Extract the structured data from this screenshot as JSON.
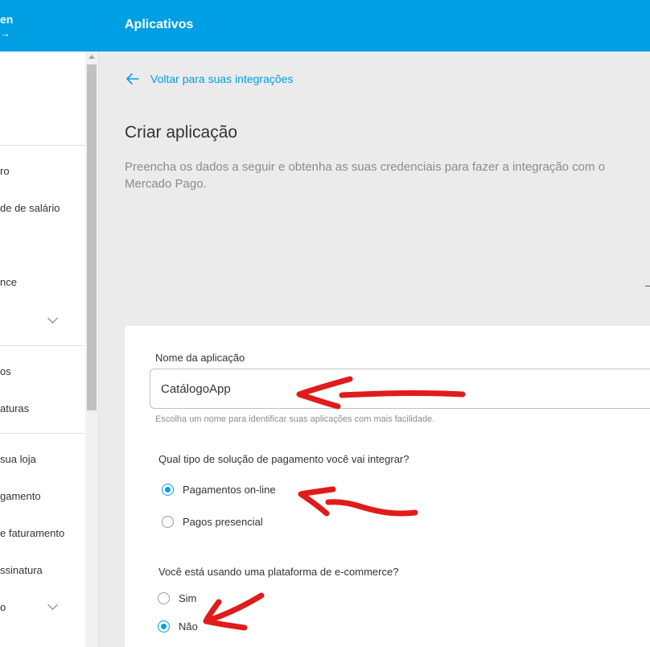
{
  "sidebar": {
    "header_name": "en",
    "header_arrow": "→",
    "items": [
      {
        "label": "ro"
      },
      {
        "label": "de de salário"
      },
      {
        "label": "nce"
      },
      {
        "label": "os"
      },
      {
        "label": "aturas"
      },
      {
        "label": "sua loja"
      },
      {
        "label": "gamento"
      },
      {
        "label": "e faturamento"
      },
      {
        "label": "ssinatura"
      },
      {
        "label": "o"
      }
    ]
  },
  "header": {
    "title": "Aplicativos"
  },
  "main": {
    "back_link": "Voltar para suas integrações",
    "title": "Criar aplicação",
    "description": "Preencha os dados a seguir e obtenha as suas credenciais para fazer a integração com o Mercado Pago."
  },
  "form": {
    "app_name_label": "Nome da aplicação",
    "app_name_value": "CatálogoApp",
    "app_name_helper": "Escolha um nome para identificar suas aplicações com mais facilidade.",
    "payment_question": "Qual tipo de solução de pagamento você vai integrar?",
    "payment_options": [
      {
        "label": "Pagamentos on-line",
        "selected": true
      },
      {
        "label": "Pagos presencial",
        "selected": false
      }
    ],
    "ecommerce_question": "Você está usando uma plataforma de e-commerce?",
    "ecommerce_options": [
      {
        "label": "Sim",
        "selected": false
      },
      {
        "label": "Não",
        "selected": true
      }
    ]
  },
  "colors": {
    "accent": "#009ee3",
    "annotation": "#e11b1b",
    "background": "#ebebeb"
  },
  "icons": [
    "arrow-left-icon",
    "chevron-down-icon"
  ]
}
